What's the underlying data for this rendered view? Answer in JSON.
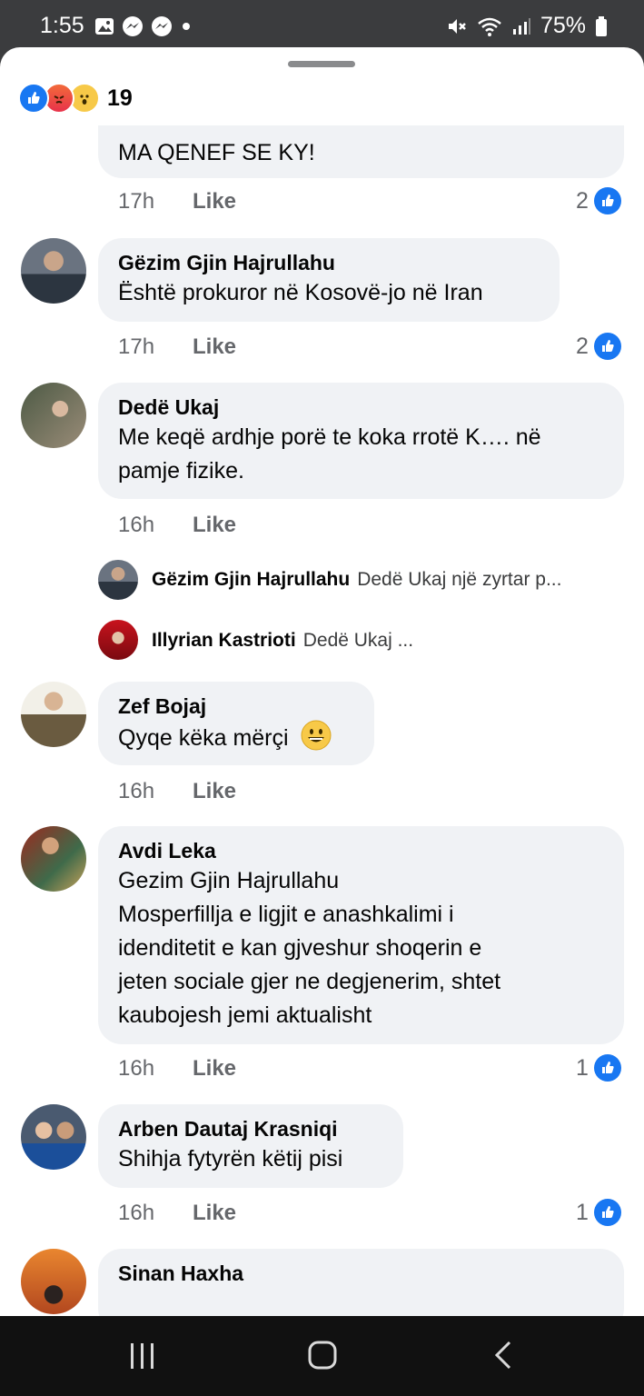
{
  "status_bar": {
    "time": "1:55",
    "battery": "75%"
  },
  "reactions": {
    "count": "19"
  },
  "comments": [
    {
      "text": "MA QENEF SE KY!",
      "time": "17h",
      "like": "Like",
      "likes": "2"
    },
    {
      "author": "Gëzim Gjin Hajrullahu",
      "text": "Është prokuror në Kosovë-jo në Iran",
      "time": "17h",
      "like": "Like",
      "likes": "2"
    },
    {
      "author": "Dedë Ukaj",
      "text_line1": "Me keqë ardhje porë te koka rrotë K…. në",
      "text_line2": "pamje fizike.",
      "time": "16h",
      "like": "Like"
    },
    {
      "author": "Zef Bojaj",
      "text": "Qyqe këka mërçi",
      "time": "16h",
      "like": "Like"
    },
    {
      "author": "Avdi Leka",
      "lines": [
        "Gezim Gjin Hajrullahu",
        "Mosperfillja e ligjit e anashkalimi i",
        "idenditetit e kan gjveshur shoqerin e",
        "jeten sociale gjer ne degjenerim, shtet",
        "kaubojesh jemi aktualisht"
      ],
      "time": "16h",
      "like": "Like",
      "likes": "1"
    },
    {
      "author": "Arben Dautaj Krasniqi",
      "text": "Shihja fytyrën këtij pisi",
      "time": "16h",
      "like": "Like",
      "likes": "1"
    },
    {
      "author": "Sinan Haxha"
    }
  ],
  "replies": [
    {
      "name": "Gëzim Gjin Hajrullahu",
      "text": "Dedë Ukaj një zyrtar p..."
    },
    {
      "name": "Illyrian Kastrioti",
      "text": "Dedë Ukaj ..."
    }
  ]
}
